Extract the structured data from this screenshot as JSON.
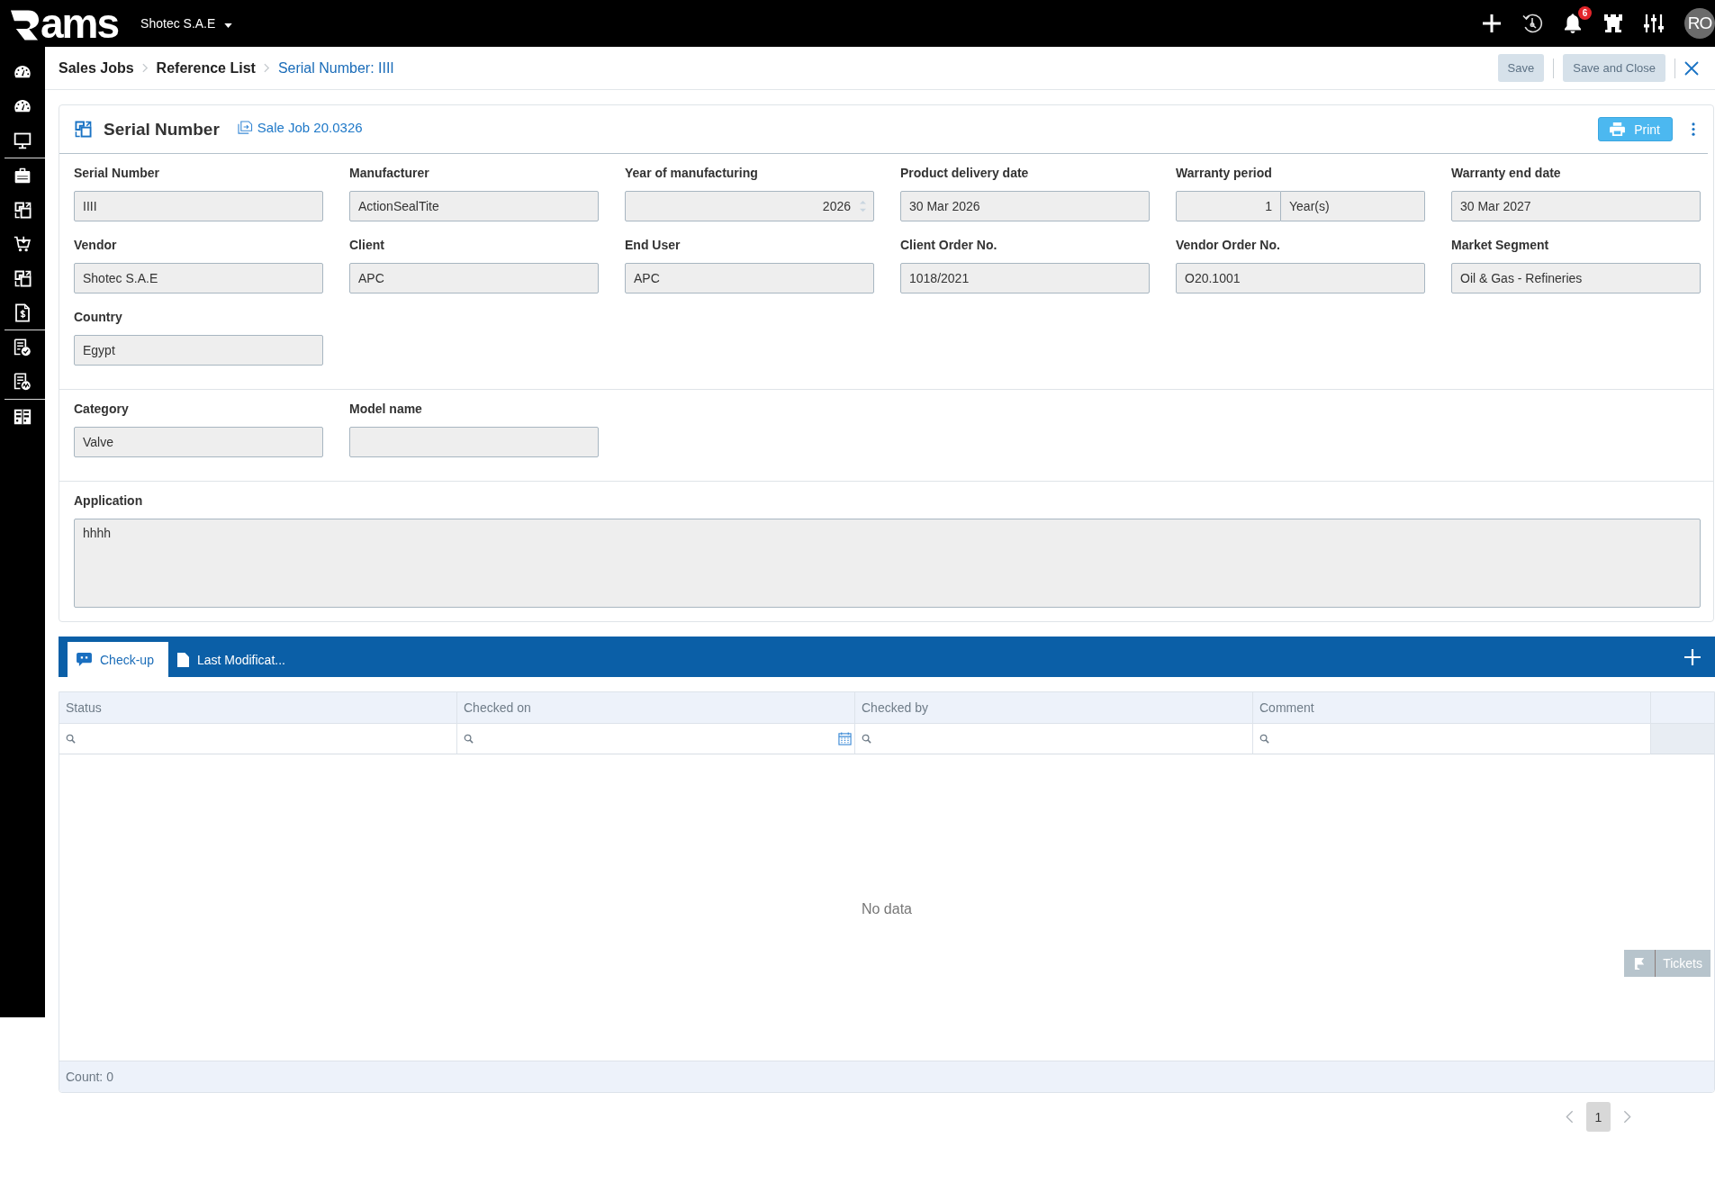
{
  "top_bar": {
    "logo_text": "ams",
    "company": "Shotec S.A.E",
    "notification_count": "6",
    "avatar_initials": "RO"
  },
  "breadcrumb": [
    {
      "label": "Sales Jobs",
      "current": false
    },
    {
      "label": "Reference List",
      "current": false
    },
    {
      "label": "Serial Number: IIII",
      "current": true
    }
  ],
  "actions": [
    {
      "label": "Save",
      "disabled": true
    },
    {
      "label": "Save and Close",
      "disabled": true
    }
  ],
  "form": {
    "title": "Serial Number",
    "link": "Sale Job 20.0326",
    "print_button": "Print",
    "sections": [
      {
        "fields": [
          {
            "label": "Serial Number",
            "kind": "text",
            "value": "IIII"
          },
          {
            "label": "Manufacturer",
            "kind": "text",
            "value": "ActionSealTite"
          },
          {
            "label": "Year of manufacturing",
            "kind": "number",
            "value": "2026"
          },
          {
            "label": "Product delivery date",
            "kind": "text",
            "value": "30 Mar 2026"
          },
          {
            "label": "Warranty period",
            "kind": "period",
            "value": "1",
            "unit": "Year(s)"
          },
          {
            "label": "Warranty end date",
            "kind": "text",
            "value": "30 Mar 2027"
          },
          {
            "label": "Vendor",
            "kind": "text",
            "value": "Shotec S.A.E"
          },
          {
            "label": "Client",
            "kind": "text",
            "value": "APC"
          },
          {
            "label": "End User",
            "kind": "text",
            "value": "APC"
          },
          {
            "label": "Client Order No.",
            "kind": "text",
            "value": "1018/2021"
          },
          {
            "label": "Vendor Order No.",
            "kind": "text",
            "value": "O20.1001"
          },
          {
            "label": "Market Segment",
            "kind": "text",
            "value": "Oil & Gas - Refineries"
          },
          {
            "label": "Country",
            "kind": "text",
            "value": "Egypt"
          }
        ]
      },
      {
        "fields": [
          {
            "label": "Category",
            "kind": "text",
            "value": "Valve"
          },
          {
            "label": "Model name",
            "kind": "text"
          }
        ]
      },
      {
        "fields": [
          {
            "label": "Application",
            "kind": "textarea",
            "value": "hhhh"
          }
        ]
      }
    ]
  },
  "details": {
    "tabs": [
      {
        "label": "Check-up",
        "selected": true
      },
      {
        "label": "Last Modificat...",
        "selected": false
      }
    ],
    "table": {
      "columns": [
        {
          "label": "Status",
          "kind": "text"
        },
        {
          "label": "Checked on",
          "kind": "date"
        },
        {
          "label": "Checked by",
          "kind": "text"
        },
        {
          "label": "Comment",
          "kind": "text"
        }
      ],
      "empty_text": "No data",
      "count": "Count: 0"
    },
    "tickets_button": "Tickets",
    "pagination": [
      {
        "label": "1",
        "selected": true
      }
    ]
  }
}
